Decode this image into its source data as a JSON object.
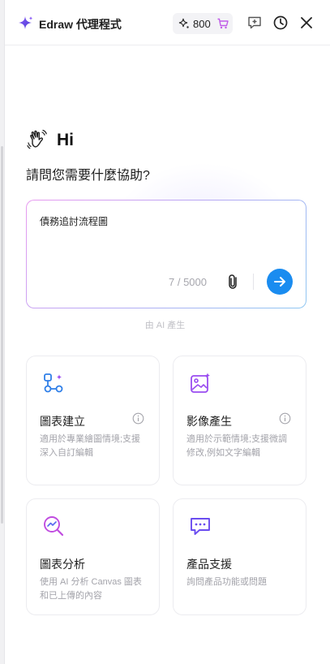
{
  "header": {
    "app_title": "Edraw 代理程式",
    "credits": "800"
  },
  "greeting": {
    "hi": "Hi",
    "question": "請問您需要什麼協助?"
  },
  "composer": {
    "prompt_value": "債務追討流程圖",
    "counter": "7 / 5000"
  },
  "ai_note": "由 AI 產生",
  "cards": [
    {
      "title": "圖表建立",
      "desc": "適用於專業繪圖情境;支援深入自訂編輯",
      "icon": "flowchart-icon"
    },
    {
      "title": "影像產生",
      "desc": "適用於示範情境;支援微調修改,例如文字編輯",
      "icon": "image-sparkle-icon"
    },
    {
      "title": "圖表分析",
      "desc": "使用 AI 分析 Canvas 圖表和已上傳的內容",
      "icon": "chart-analysis-icon"
    },
    {
      "title": "產品支援",
      "desc": "詢問產品功能或問題",
      "icon": "chat-support-icon"
    }
  ],
  "colors": {
    "accent_blue": "#1a8cf0",
    "logo_purple": "#6a4cf0",
    "card_icon_blue": "#2f7fe8",
    "card_icon_purple": "#9a4cf0"
  }
}
